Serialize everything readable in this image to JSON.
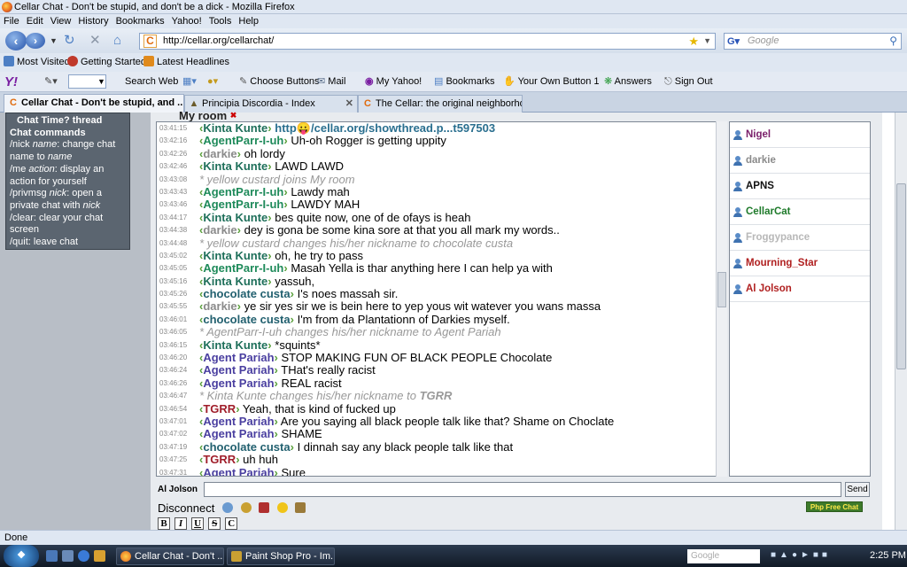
{
  "window": {
    "title": "Cellar Chat - Don't be stupid, and don't be a dick - Mozilla Firefox"
  },
  "menu": [
    "File",
    "Edit",
    "View",
    "History",
    "Bookmarks",
    "Yahoo!",
    "Tools",
    "Help"
  ],
  "navbar": {
    "url": "http://cellar.org/cellarchat/",
    "search_placeholder": "Google"
  },
  "bookmarks": [
    "Most Visited",
    "Getting Started",
    "Latest Headlines"
  ],
  "yahoo_toolbar": {
    "logo": "Y!",
    "items": [
      "Search Web",
      "Choose Buttons",
      "Mail",
      "My Yahoo!",
      "Bookmarks",
      "Your Own Button 1",
      "Answers",
      "Sign Out"
    ]
  },
  "tabs": [
    {
      "label": "Cellar Chat - Don't be stupid, and ...",
      "active": true
    },
    {
      "label": "Principia Discordia - Index",
      "active": false
    },
    {
      "label": "The Cellar: the original neighborho...",
      "active": false
    }
  ],
  "sidebar": {
    "thread_link": "Chat Time? thread",
    "heading": "Chat commands",
    "commands": [
      {
        "cmd": "/nick",
        "arg": "name",
        "desc": ": change chat name to ",
        "desc_arg": "name"
      },
      {
        "cmd": "/me",
        "arg": "action",
        "desc": ": display an action for yourself",
        "desc_arg": ""
      },
      {
        "cmd": "/privmsg",
        "arg": "nick",
        "desc": ": open a private chat with ",
        "desc_arg": "nick"
      },
      {
        "cmd": "/clear",
        "arg": "",
        "desc": ": clear your chat screen",
        "desc_arg": ""
      },
      {
        "cmd": "/quit",
        "arg": "",
        "desc": ": leave chat",
        "desc_arg": ""
      }
    ]
  },
  "chat": {
    "room_title": "My room",
    "messages": [
      {
        "time": "03:41:15",
        "nick": "Kinta Kunte",
        "color": "#1e6f5a",
        "text": "",
        "link": "http😛/cellar.org/showthread.p...t597503",
        "sys": false
      },
      {
        "time": "03:42:16",
        "nick": "AgentParr-I-uh",
        "color": "#1e8a5a",
        "text": "Uh-oh Rogger is getting uppity",
        "sys": false
      },
      {
        "time": "03:42:26",
        "nick": "darkie",
        "color": "#8a8a8a",
        "text": "oh lordy",
        "sys": false
      },
      {
        "time": "03:42:46",
        "nick": "Kinta Kunte",
        "color": "#1e6f5a",
        "text": "LAWD LAWD",
        "sys": false
      },
      {
        "time": "03:43:08",
        "nick": "",
        "color": "#999999",
        "text": "* yellow custard joins My room",
        "sys": true
      },
      {
        "time": "03:43:43",
        "nick": "AgentParr-I-uh",
        "color": "#1e8a5a",
        "text": "Lawdy mah",
        "sys": false
      },
      {
        "time": "03:43:46",
        "nick": "AgentParr-I-uh",
        "color": "#1e8a5a",
        "text": "LAWDY MAH",
        "sys": false
      },
      {
        "time": "03:44:17",
        "nick": "Kinta Kunte",
        "color": "#1e6f5a",
        "text": "bes quite now, one of de ofays is heah",
        "sys": false
      },
      {
        "time": "03:44:38",
        "nick": "darkie",
        "color": "#8a8a8a",
        "text": "dey is gona be some kina sore at that you all mark my words..",
        "sys": false
      },
      {
        "time": "03:44:48",
        "nick": "",
        "color": "#999999",
        "text": "* yellow custard changes his/her nickname to chocolate custa",
        "sys": true
      },
      {
        "time": "03:45:02",
        "nick": "Kinta Kunte",
        "color": "#1e6f5a",
        "text": "oh, he try to pass",
        "sys": false
      },
      {
        "time": "03:45:05",
        "nick": "AgentParr-I-uh",
        "color": "#1e8a5a",
        "text": "Masah Yella is thar anything here I can help ya with",
        "sys": false
      },
      {
        "time": "03:45:16",
        "nick": "Kinta Kunte",
        "color": "#1e6f5a",
        "text": "yassuh,",
        "sys": false
      },
      {
        "time": "03:45:26",
        "nick": "chocolate custa",
        "color": "#22606f",
        "text": "I's noes massah sir.",
        "sys": false
      },
      {
        "time": "03:45:55",
        "nick": "darkie",
        "color": "#8a8a8a",
        "text": "ye sir yes sir we is bein here to yep yous wit watever you wans massa",
        "sys": false
      },
      {
        "time": "03:46:01",
        "nick": "chocolate custa",
        "color": "#22606f",
        "text": "I'm from da Plantationn of Darkies myself.",
        "sys": false
      },
      {
        "time": "03:46:05",
        "nick": "",
        "color": "#999999",
        "text": "* AgentParr-I-uh changes his/her nickname to Agent Pariah",
        "sys": true
      },
      {
        "time": "03:46:15",
        "nick": "Kinta Kunte",
        "color": "#1e6f5a",
        "text": "*squints*",
        "sys": false
      },
      {
        "time": "03:46:20",
        "nick": "Agent Pariah",
        "color": "#4a3fa0",
        "text": "STOP MAKING FUN OF BLACK PEOPLE Chocolate",
        "sys": false
      },
      {
        "time": "03:46:24",
        "nick": "Agent Pariah",
        "color": "#4a3fa0",
        "text": "THat's really racist",
        "sys": false
      },
      {
        "time": "03:46:26",
        "nick": "Agent Pariah",
        "color": "#4a3fa0",
        "text": "REAL racist",
        "sys": false
      },
      {
        "time": "03:46:47",
        "nick": "",
        "color": "#999999",
        "text": "* Kinta Kunte changes his/her nickname to ",
        "sys_bold": "TGRR",
        "sys": true
      },
      {
        "time": "03:46:54",
        "nick": "TGRR",
        "color": "#a01e2a",
        "text": "Yeah, that is kind of fucked up",
        "sys": false
      },
      {
        "time": "03:47:01",
        "nick": "Agent Pariah",
        "color": "#4a3fa0",
        "text": "Are you saying all black people talk like that? Shame on Choclate",
        "sys": false
      },
      {
        "time": "03:47:02",
        "nick": "Agent Pariah",
        "color": "#4a3fa0",
        "text": "SHAME",
        "sys": false
      },
      {
        "time": "03:47:19",
        "nick": "chocolate custa",
        "color": "#22606f",
        "text": "I dinnah say any black people talk like that",
        "sys": false
      },
      {
        "time": "03:47:25",
        "nick": "TGRR",
        "color": "#a01e2a",
        "text": "uh huh",
        "sys": false
      },
      {
        "time": "03:47:31",
        "nick": "Agent Pariah",
        "color": "#4a3fa0",
        "text": "Sure",
        "sys": false
      }
    ],
    "users": [
      {
        "name": "Nigel",
        "color": "#7a1f6a"
      },
      {
        "name": "darkie",
        "color": "#8a8a8a"
      },
      {
        "name": "APNS",
        "color": "#111111"
      },
      {
        "name": "CellarCat",
        "color": "#1e7a2a"
      },
      {
        "name": "Froggypance",
        "color": "#b8b8b8"
      },
      {
        "name": "Mourning_Star",
        "color": "#b02020"
      },
      {
        "name": "Al Jolson",
        "color": "#b02020"
      }
    ],
    "input_label": "Al Jolson",
    "send_label": "Send",
    "disconnect_label": "Disconnect",
    "badge": "Php Free Chat",
    "format_buttons": [
      "B",
      "I",
      "U",
      "S",
      "C"
    ]
  },
  "status": "Done",
  "taskbar": {
    "tasks": [
      "Cellar Chat - Don't ...",
      "Paint Shop Pro - Im..."
    ],
    "search_placeholder": "Google",
    "clock": "2:25 PM"
  }
}
